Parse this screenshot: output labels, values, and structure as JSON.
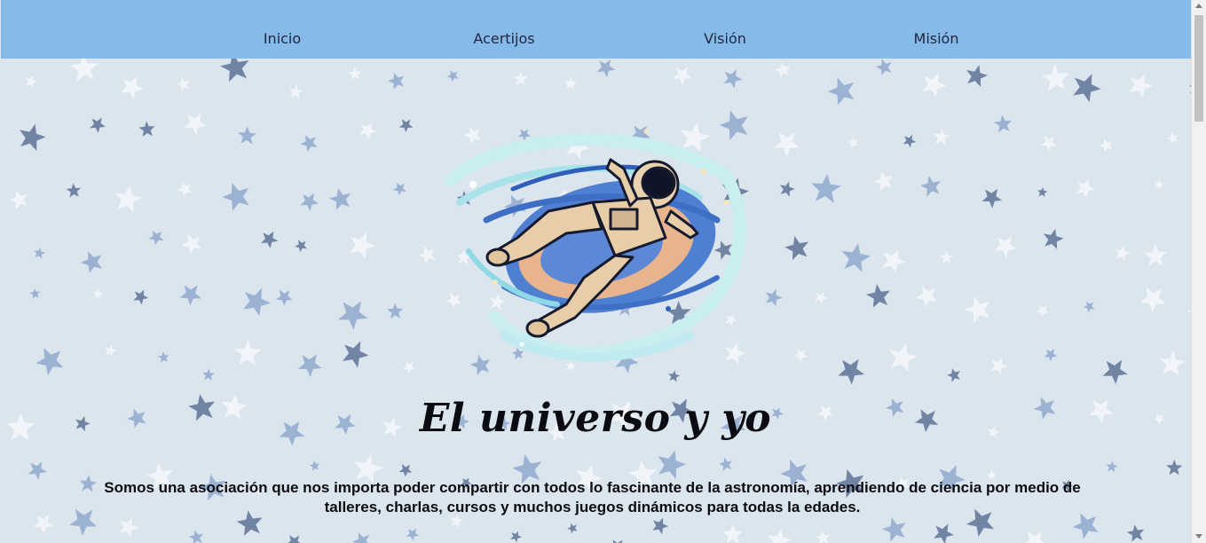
{
  "nav": {
    "items": [
      {
        "label": "Inicio"
      },
      {
        "label": "Acertijos"
      },
      {
        "label": "Visión"
      },
      {
        "label": "Misión"
      }
    ]
  },
  "hero": {
    "title": "El universo y yo",
    "description": "Somos una asociación que nos importa poder compartir con todos lo fascinante de la astronomía, aprendiendo de ciencia por medio de talleres, charlas, cursos y muchos juegos dinámicos para todas la edades.",
    "illustration_icon": "astronaut-galaxy-icon"
  },
  "colors": {
    "nav_bg": "#86bbe9",
    "page_bg": "#dbe5ee",
    "star_dark": "#5f7396",
    "star_mid": "#8fa9cc",
    "star_light": "#f3f6fa"
  }
}
